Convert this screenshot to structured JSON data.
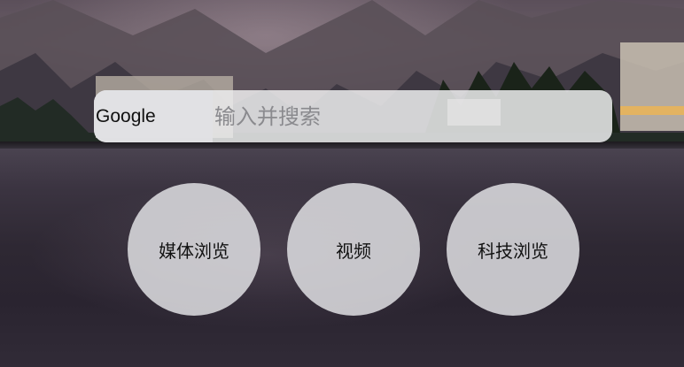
{
  "search": {
    "engine_label": "Google",
    "placeholder": "输入并搜索"
  },
  "shortcuts": [
    {
      "label": "媒体浏览"
    },
    {
      "label": "视频"
    },
    {
      "label": "科技浏览"
    }
  ],
  "background": {
    "description_icon": "mountain-lake-photo"
  }
}
